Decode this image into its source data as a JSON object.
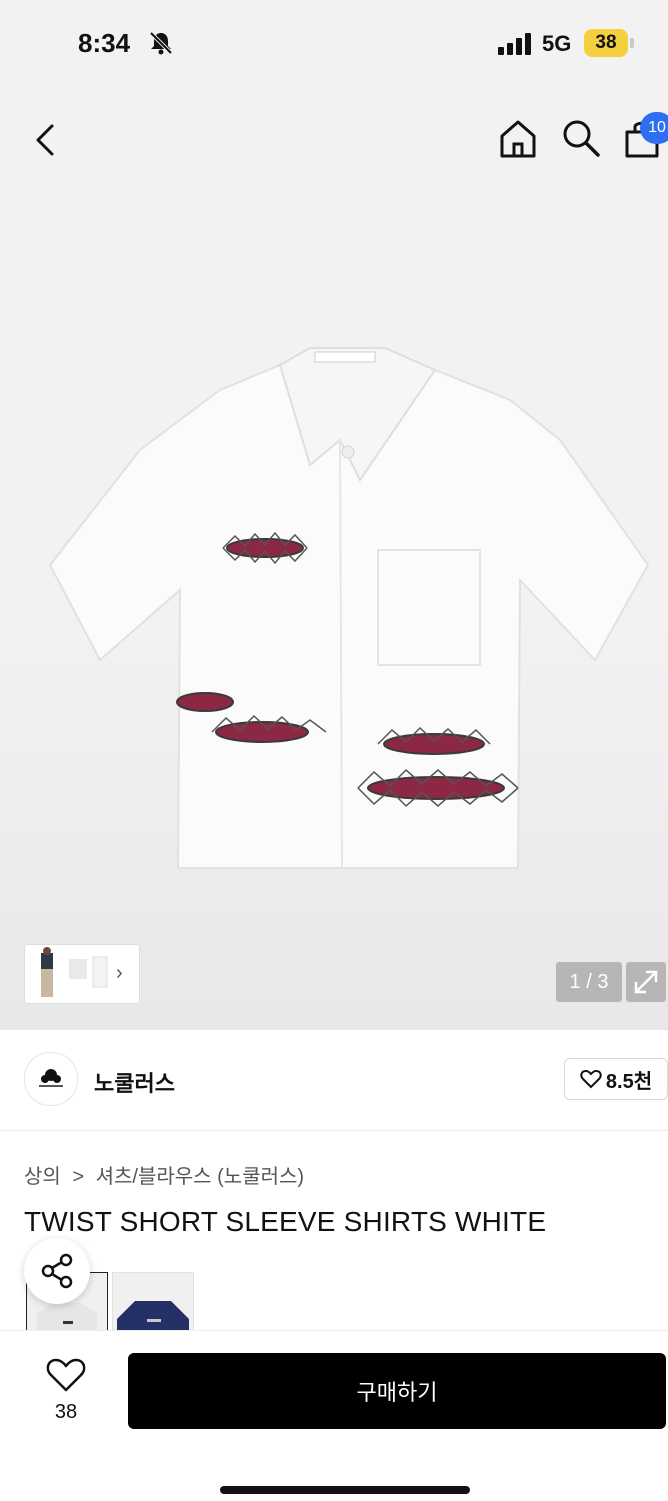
{
  "status_bar": {
    "time": "8:34",
    "network": "5G",
    "battery": "38"
  },
  "nav": {
    "cart_badge": "10"
  },
  "gallery": {
    "counter": "1 / 3"
  },
  "brand": {
    "name": "노쿨러스",
    "likes": "8.5천"
  },
  "breadcrumb": {
    "category": "상의",
    "separator": ">",
    "subcategory": "셔츠/블라우스 (노쿨러스)"
  },
  "product": {
    "title": "TWIST SHORT SLEEVE SHIRTS WHITE"
  },
  "bottom_bar": {
    "wish_count": "38",
    "buy_label": "구매하기"
  },
  "colors": {
    "accent_blue": "#2e6ef0",
    "battery_yellow": "#f4d03f",
    "buy_button": "#000000"
  }
}
